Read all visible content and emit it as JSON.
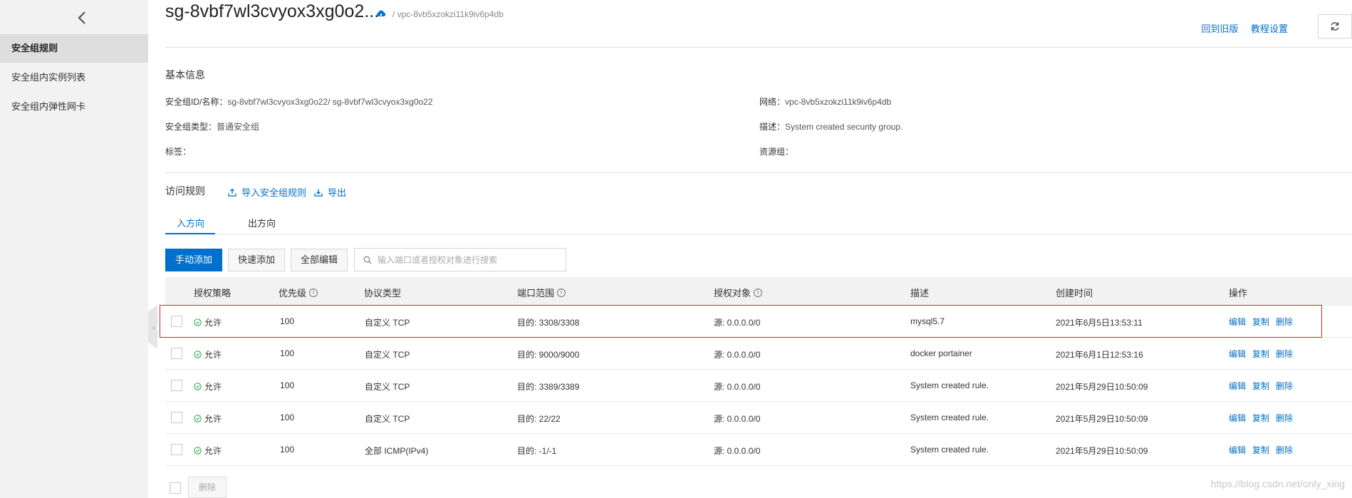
{
  "header": {
    "title": "sg-8vbf7wl3cvyox3xg0o2...",
    "vpc_crumb": "/ vpc-8vb5xzokzi11k9iv6p4db",
    "back_to_old": "回到旧版",
    "tutorial_settings": "教程设置"
  },
  "sidebar": {
    "items": [
      {
        "label": "安全组规则"
      },
      {
        "label": "安全组内实例列表"
      },
      {
        "label": "安全组内弹性网卡"
      }
    ]
  },
  "basic_info": {
    "title": "基本信息",
    "sg_id_label": "安全组ID/名称：",
    "sg_id_value": "sg-8vbf7wl3cvyox3xg0o22/ sg-8vbf7wl3cvyox3xg0o22",
    "type_label": "安全组类型：",
    "type_value": "普通安全组",
    "tags_label": "标签：",
    "network_label": "网络：",
    "network_value": "vpc-8vb5xzokzi11k9iv6p4db",
    "desc_label": "描述：",
    "desc_value": "System created security group.",
    "resource_group_label": "资源组："
  },
  "rules": {
    "title": "访问规则",
    "import_label": "导入安全组规则",
    "export_label": "导出"
  },
  "tabs": [
    {
      "label": "入方向"
    },
    {
      "label": "出方向"
    }
  ],
  "toolbar": {
    "manual_add": "手动添加",
    "quick_add": "快速添加",
    "edit_all": "全部编辑",
    "search_placeholder": "输入端口或者授权对象进行搜索"
  },
  "table": {
    "columns": [
      "授权策略",
      "优先级",
      "协议类型",
      "端口范围",
      "授权对象",
      "描述",
      "创建时间",
      "操作"
    ],
    "rows": [
      {
        "policy": "允许",
        "priority": "100",
        "protocol": "自定义 TCP",
        "port": "目的: 3308/3308",
        "source": "源: 0.0.0.0/0",
        "desc": "mysql5.7",
        "created": "2021年6月5日13:53:11"
      },
      {
        "policy": "允许",
        "priority": "100",
        "protocol": "自定义 TCP",
        "port": "目的: 9000/9000",
        "source": "源: 0.0.0.0/0",
        "desc": "docker portainer",
        "created": "2021年6月1日12:53:16"
      },
      {
        "policy": "允许",
        "priority": "100",
        "protocol": "自定义 TCP",
        "port": "目的: 3389/3389",
        "source": "源: 0.0.0.0/0",
        "desc": "System created rule.",
        "created": "2021年5月29日10:50:09"
      },
      {
        "policy": "允许",
        "priority": "100",
        "protocol": "自定义 TCP",
        "port": "目的: 22/22",
        "source": "源: 0.0.0.0/0",
        "desc": "System created rule.",
        "created": "2021年5月29日10:50:09"
      },
      {
        "policy": "允许",
        "priority": "100",
        "protocol": "全部 ICMP(IPv4)",
        "port": "目的: -1/-1",
        "source": "源: 0.0.0.0/0",
        "desc": "System created rule.",
        "created": "2021年5月29日10:50:09"
      }
    ],
    "ops": {
      "edit": "编辑",
      "copy": "复制",
      "delete": "删除"
    },
    "bulk_delete": "删除"
  },
  "watermark": "https://blog.csdn.net/only_xing",
  "colors": {
    "accent": "#0070cc",
    "highlight": "#e02020",
    "allow": "#2db84d",
    "brand": "#ff6a00"
  }
}
